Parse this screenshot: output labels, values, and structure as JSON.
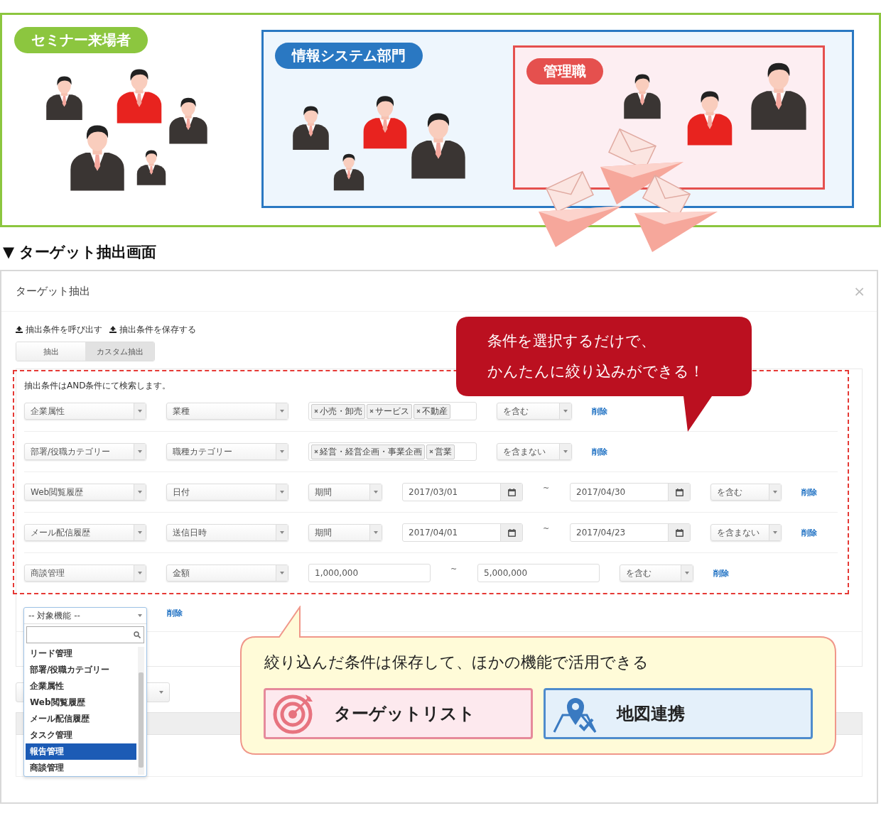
{
  "illustration": {
    "groups": [
      {
        "label": "セミナー来場者",
        "color": "#8cc63f",
        "people": [
          {
            "color": "#3a3533"
          },
          {
            "color": "#e8231f"
          },
          {
            "color": "#3a3533"
          },
          {
            "color": "#3a3533"
          },
          {
            "color": "#3a3533"
          }
        ]
      },
      {
        "label": "情報システム部門",
        "color": "#2a78c2",
        "people": [
          {
            "color": "#3a3533"
          },
          {
            "color": "#e8231f"
          },
          {
            "color": "#3a3533"
          },
          {
            "color": "#3a3533"
          }
        ]
      },
      {
        "label": "管理職",
        "color": "#e5504e",
        "people": [
          {
            "color": "#3a3533"
          },
          {
            "color": "#e8231f"
          },
          {
            "color": "#3a3533"
          }
        ]
      }
    ]
  },
  "section_heading": "▼ ターゲット抽出画面",
  "modal": {
    "title": "ターゲット抽出",
    "close": "×",
    "actions": [
      "抽出条件を呼び出す",
      "抽出条件を保存する"
    ],
    "tabs": [
      {
        "label": "抽出",
        "selected": false
      },
      {
        "label": "カスタム抽出",
        "selected": true
      }
    ],
    "note": "抽出条件はAND条件にて検索します。",
    "rows": [
      {
        "kind": "tags",
        "target": "企業属性",
        "item": "業種",
        "tags": [
          "小売・卸売",
          "サービス",
          "不動産"
        ],
        "operator": "を含む",
        "delete": "削除"
      },
      {
        "kind": "tags",
        "target": "部署/役職カテゴリー",
        "item": "職種カテゴリー",
        "tags": [
          "経営・経営企画・事業企画",
          "営業"
        ],
        "operator": "を含まない",
        "delete": "削除"
      },
      {
        "kind": "date_range",
        "target": "Web閲覧履歴",
        "item": "日付",
        "period": "期間",
        "from": "2017/03/01",
        "tilde": "~",
        "to": "2017/04/30",
        "operator": "を含む",
        "delete": "削除"
      },
      {
        "kind": "date_range",
        "target": "メール配信履歴",
        "item": "送信日時",
        "period": "期間",
        "from": "2017/04/01",
        "tilde": "~",
        "to": "2017/04/23",
        "operator": "を含まない",
        "delete": "削除"
      },
      {
        "kind": "number_range",
        "target": "商談管理",
        "item": "金額",
        "from": "1,000,000",
        "tilde": "~",
        "to": "5,000,000",
        "operator": "を含む",
        "delete": "削除"
      }
    ],
    "new_row": {
      "delete": "削除"
    },
    "dropdown": {
      "value": "-- 対象機能 --",
      "options": [
        {
          "label": "リード管理",
          "selected": false
        },
        {
          "label": "部署/役職カテゴリー",
          "selected": false
        },
        {
          "label": "企業属性",
          "selected": false
        },
        {
          "label": "Web閲覧履歴",
          "selected": false
        },
        {
          "label": "メール配信履歴",
          "selected": false
        },
        {
          "label": "タスク管理",
          "selected": false
        },
        {
          "label": "報告管理",
          "selected": true
        },
        {
          "label": "商談管理",
          "selected": false
        }
      ]
    }
  },
  "callouts": [
    {
      "kind": "red",
      "lines": [
        "条件を選択するだけで、",
        "かんたんに絞り込みができる！"
      ]
    },
    {
      "kind": "yellow",
      "text": "絞り込んだ条件は保存して、ほかの機能で活用できる",
      "buttons": [
        {
          "label": "ターゲットリスト",
          "kind": "target"
        },
        {
          "label": "地図連携",
          "kind": "map"
        }
      ]
    }
  ]
}
